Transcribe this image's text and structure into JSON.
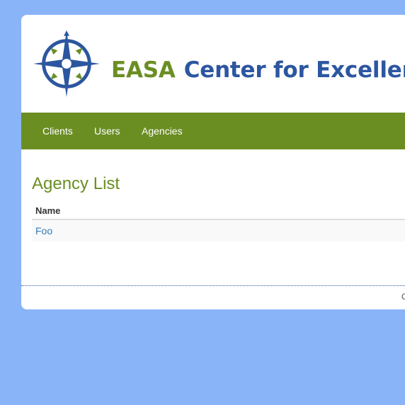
{
  "brand": {
    "emblem": "compass-rose-logo",
    "abbr": "EASA",
    "name": "Center for Excellence",
    "colors": {
      "green": "#6b8e23",
      "blue": "#2c56a0"
    }
  },
  "nav": {
    "items": [
      {
        "label": "Clients"
      },
      {
        "label": "Users"
      },
      {
        "label": "Agencies"
      }
    ],
    "background": "#6b8e23"
  },
  "main": {
    "title": "Agency List",
    "table": {
      "columns": [
        "Name"
      ],
      "rows": [
        {
          "name": "Foo"
        }
      ]
    }
  },
  "footer": {
    "text": "C"
  },
  "colors": {
    "page_background": "#8ab4f8",
    "link": "#337ab7"
  }
}
